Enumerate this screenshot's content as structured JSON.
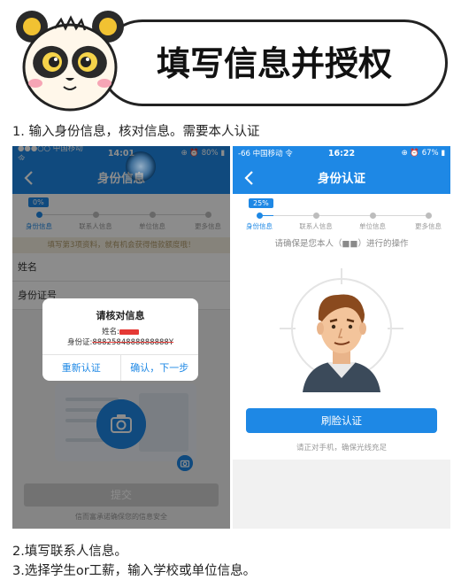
{
  "header": {
    "title": "填写信息并授权"
  },
  "steps_caption": {
    "step1": "1. 输入身份信息，核对信息。需要本人认证",
    "step2": "2.填写联系人信息。",
    "step3": "3.选择学生or工薪，输入学校或单位信息。"
  },
  "phone1": {
    "status": {
      "carrier": "●●●○○ 中国移动 令",
      "time": "14:01",
      "battery": "⊕ ⏰ 80% ▮"
    },
    "nav_title": "身份信息",
    "progress_percent": 0,
    "progress_label": "0%",
    "steps": [
      "身份信息",
      "联系人信息",
      "单位信息",
      "更多信息"
    ],
    "notice": "填写第3项资料，就有机会获得借款额度哦！",
    "fields": {
      "name_label": "姓名",
      "id_label": "身份证号"
    },
    "dialog": {
      "title": "请核对信息",
      "name_label": "姓名:",
      "id_label": "身份证:",
      "id_value": "8882584888888888Y",
      "retry": "重新认证",
      "confirm": "确认，下一步"
    },
    "submit": "提交",
    "footnote": "信而富承诺确保您的信息安全"
  },
  "phone2": {
    "status": {
      "carrier": "-66 中国移动 令",
      "time": "16:22",
      "battery": "⊕ ⏰ 67% ▮"
    },
    "nav_title": "身份认证",
    "progress_percent": 25,
    "progress_label": "25%",
    "steps": [
      "身份信息",
      "联系人信息",
      "单位信息",
      "更多信息"
    ],
    "hint": "请确保是您本人（■■）进行的操作",
    "face_button": "刷脸认证",
    "tip": "请正对手机，确保光线充足"
  },
  "colors": {
    "brand_blue": "#1e88e5",
    "redaction": "#e53935"
  }
}
